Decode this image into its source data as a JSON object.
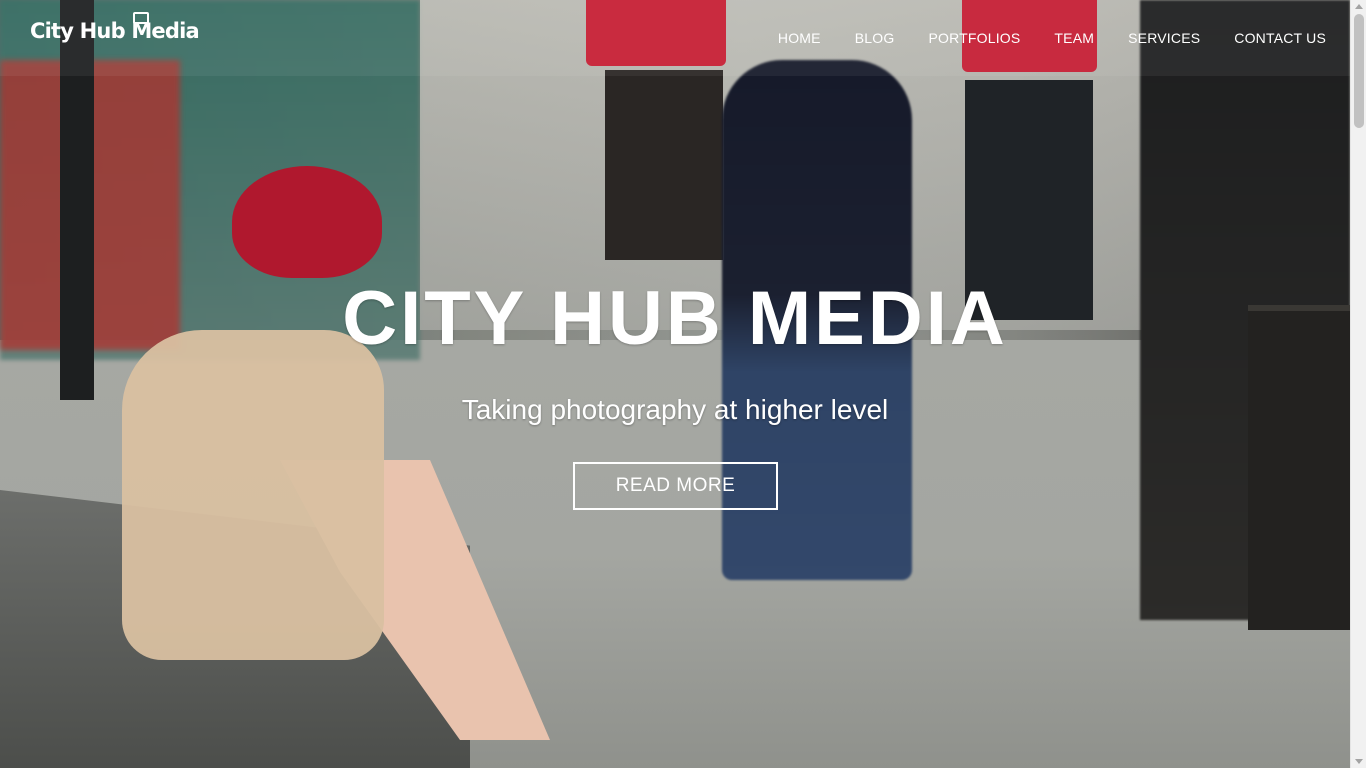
{
  "brand": {
    "logo_text": "City Hub Media"
  },
  "nav": {
    "items": [
      {
        "label": "HOME"
      },
      {
        "label": "BLOG"
      },
      {
        "label": "PORTFOLIOS"
      },
      {
        "label": "TEAM"
      },
      {
        "label": "SERVICES"
      },
      {
        "label": "CONTACT US"
      }
    ]
  },
  "hero": {
    "title": "CITY HUB MEDIA",
    "subtitle": "Taking photography at higher level",
    "cta_label": "READ MORE"
  },
  "colors": {
    "text": "#ffffff",
    "accent_hat": "#b0182e",
    "awning": "#c61e34"
  },
  "icons": {
    "logo_mark": "camera-bag-icon"
  }
}
